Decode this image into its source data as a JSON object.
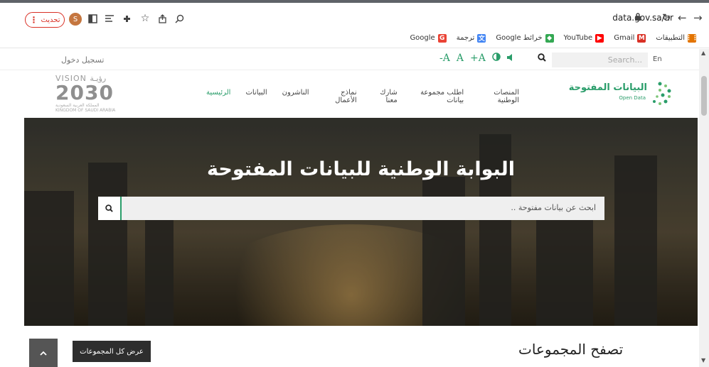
{
  "browser": {
    "update_label": "تحديث",
    "update_dots": "⋮",
    "profile_initial": "S",
    "url": "data.gov.sa/ar"
  },
  "bookmarks": [
    {
      "label": "التطبيقات",
      "icon": "apps-grid-icon",
      "color": "#e37400",
      "glyph": "⋮⋮"
    },
    {
      "label": "Gmail",
      "icon": "gmail-icon",
      "color": "#d93025",
      "glyph": "M"
    },
    {
      "label": "YouTube",
      "icon": "youtube-icon",
      "color": "#ff0000",
      "glyph": "▶"
    },
    {
      "label": "خرائط Google",
      "icon": "maps-icon",
      "color": "#34a853",
      "glyph": "◆"
    },
    {
      "label": "ترجمة",
      "icon": "translate-icon",
      "color": "#4285f4",
      "glyph": "文"
    },
    {
      "label": "Google",
      "icon": "google-icon",
      "color": "#ea4335",
      "glyph": "G"
    }
  ],
  "utility": {
    "login": "تسجيل دخول",
    "font_decrease": "-A",
    "font_normal": "A",
    "font_increase": "+A",
    "search_placeholder": "Search...",
    "lang": "En"
  },
  "nav": {
    "vision_text": "VISION رؤيـة",
    "vision_number": "2030",
    "vision_kingdom": "المملكة العربية السعودية KINGDOM OF SAUDI ARABIA",
    "links": [
      {
        "label": "الرئيسية",
        "active": true
      },
      {
        "label": "البيانات",
        "active": false
      },
      {
        "label": "الناشرون",
        "active": false
      },
      {
        "label": "نماذج الأعمال",
        "active": false
      },
      {
        "label": "شارك معنا",
        "active": false
      },
      {
        "label": "اطلب مجموعة بيانات",
        "active": false
      },
      {
        "label": "المنصات الوطنية",
        "active": false
      }
    ],
    "logo_title": "البيانات المفتوحة",
    "logo_subtitle": "Open Data"
  },
  "hero": {
    "title": "البوابة الوطنية للبيانات المفتوحة",
    "search_placeholder": "ابحث عن بيانات مفتوحة .."
  },
  "groups": {
    "title": "تصفح المجموعات",
    "view_all": "عرض كل المجموعات"
  },
  "colors": {
    "brand_green": "#2a9d6a",
    "update_red": "#d93025"
  }
}
